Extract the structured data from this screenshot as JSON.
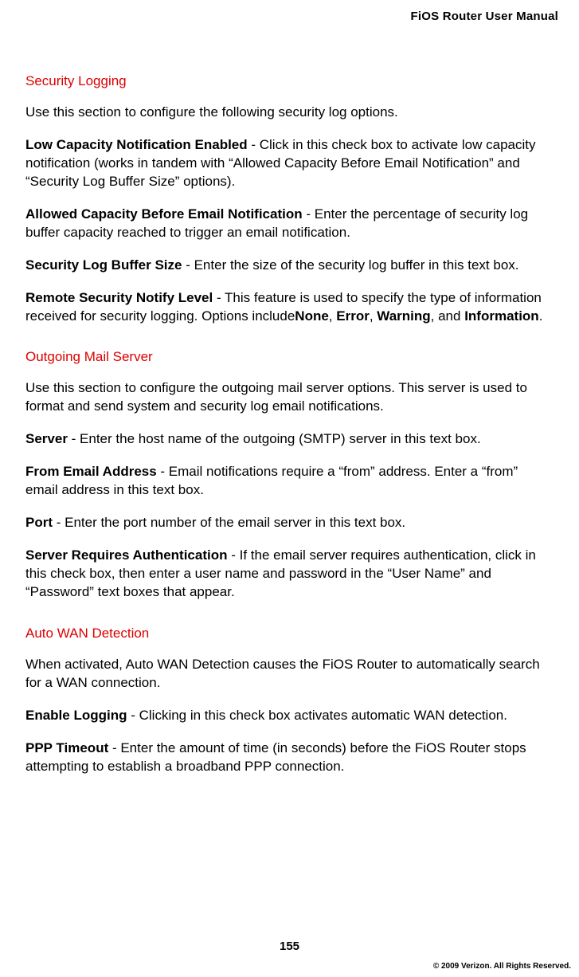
{
  "header": {
    "title": "FiOS Router User Manual"
  },
  "sections": {
    "security_logging": {
      "heading": "Security Logging",
      "intro": "Use this section to configure the following security log options.",
      "items": {
        "low_capacity": {
          "label": "Low Capacity Notification Enabled",
          "desc": " - Click in this check box to activate low capacity notification (works in tandem with “Allowed Capacity Before Email Notification” and “Security Log Buffer Size” options)."
        },
        "allowed_capacity": {
          "label": "Allowed Capacity Before Email Notification",
          "desc": " - Enter the percentage of security log buffer capacity reached to trigger an email notification."
        },
        "buffer_size": {
          "label": "Security Log Buffer Size",
          "desc": " - Enter the size of the security log buffer in this text box."
        },
        "notify_level": {
          "label": "Remote Security Notify Level",
          "desc_pre": " - This feature is used to specify the type of information received for security logging. Options include",
          "opt1": "None",
          "sep1": ", ",
          "opt2": "Error",
          "sep2": ", ",
          "opt3": "Warning",
          "sep3": ", and ",
          "opt4": "Information",
          "desc_post": "."
        }
      }
    },
    "outgoing_mail": {
      "heading": "Outgoing Mail Server",
      "intro": "Use this section to configure the outgoing mail server options. This server is used to format and send system and security log email notifications.",
      "items": {
        "server": {
          "label": "Server",
          "desc": " - Enter the host name of the outgoing (SMTP) server in this text box."
        },
        "from_email": {
          "label": "From Email Address",
          "desc": " - Email notifications require a “from” address. Enter a “from” email address in this text box."
        },
        "port": {
          "label": "Port",
          "desc": " - Enter the port number of the email server in this text box."
        },
        "auth": {
          "label": "Server Requires Authentication",
          "desc": " - If the email server requires authentication, click in this check box, then enter a user name and password in the “User Name” and “Password” text boxes that appear."
        }
      }
    },
    "auto_wan": {
      "heading": "Auto WAN Detection",
      "intro": "When activated, Auto WAN Detection causes the FiOS Router to automatically search for a WAN connection.",
      "items": {
        "enable_logging": {
          "label": "Enable Logging",
          "desc": " - Clicking in this check box activates automatic WAN detection."
        },
        "ppp_timeout": {
          "label": "PPP Timeout",
          "desc": " - Enter the amount of time (in seconds) before the FiOS Router stops attempting to establish a broadband PPP connection."
        }
      }
    }
  },
  "footer": {
    "page_number": "155",
    "copyright": "© 2009 Verizon. All Rights Reserved."
  }
}
